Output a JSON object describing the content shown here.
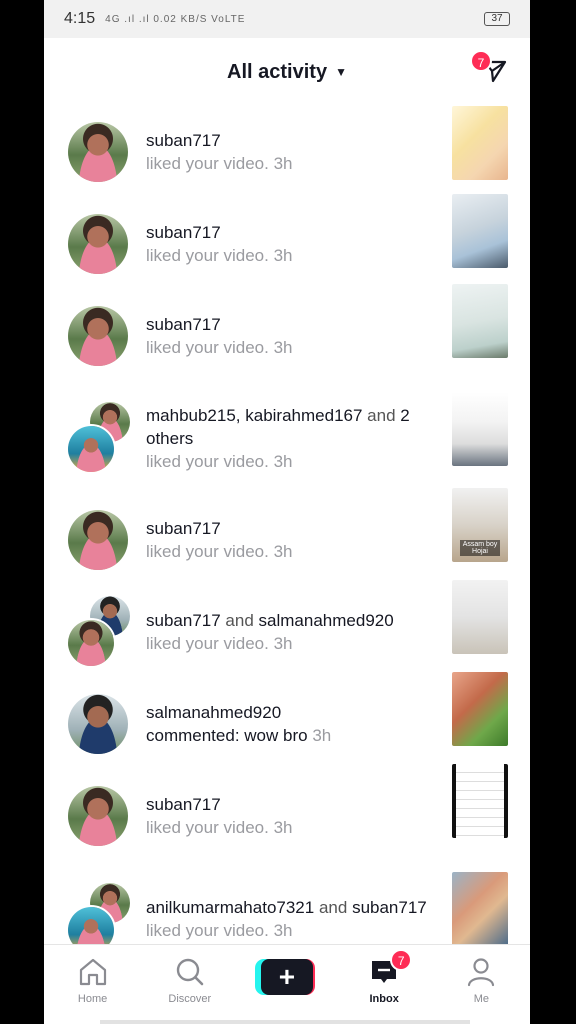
{
  "status_bar": {
    "time": "4:15",
    "signal_text": "4G .ıl .ıl 0.02 KB/S VoLTE",
    "battery": "37"
  },
  "header": {
    "title": "All activity",
    "dm_badge": "7"
  },
  "notifications": [
    {
      "names": "suban717",
      "conj": "",
      "names2": "",
      "action": "liked your video.",
      "time": "3h",
      "avatar": "single"
    },
    {
      "names": "suban717",
      "conj": "",
      "names2": "",
      "action": "liked your video.",
      "time": "3h",
      "avatar": "single"
    },
    {
      "names": "suban717",
      "conj": "",
      "names2": "",
      "action": "liked your video.",
      "time": "3h",
      "avatar": "single"
    },
    {
      "names": "mahbub215, kabirahmed167",
      "conj": "and",
      "names2": "2 others",
      "action": "liked your video.",
      "time": "3h",
      "avatar": "double"
    },
    {
      "names": "suban717",
      "conj": "",
      "names2": "",
      "action": "liked your video.",
      "time": "3h",
      "avatar": "single"
    },
    {
      "names": "suban717",
      "conj": "and",
      "names2": "salmanahmed920",
      "action": "liked your video.",
      "time": "3h",
      "avatar": "double"
    },
    {
      "names": "salmanahmed920",
      "conj": "",
      "names2": "",
      "action": "commented: wow bro",
      "time": "3h",
      "avatar": "single"
    },
    {
      "names": "suban717",
      "conj": "",
      "names2": "",
      "action": "liked your video.",
      "time": "3h",
      "avatar": "single"
    },
    {
      "names": "anilkumarmahato7321",
      "conj": "and",
      "names2": "suban717",
      "action": "liked your video.",
      "time": "3h",
      "avatar": "double"
    }
  ],
  "thumbnail_texts": {
    "row5": "Assam boy Hojai"
  },
  "bottom_nav": {
    "home": "Home",
    "discover": "Discover",
    "create": "+",
    "inbox": "Inbox",
    "inbox_badge": "7",
    "me": "Me"
  },
  "colors": {
    "accent": "#fe2c55",
    "cyan": "#25f4ee",
    "text_primary": "#161823",
    "text_secondary": "#9a9ba0"
  }
}
